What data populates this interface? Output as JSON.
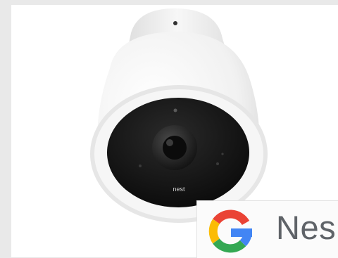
{
  "product_photo": {
    "subject": "security-camera",
    "lens_brand_text": "nest"
  },
  "overlay": {
    "logo": "google-g-logo",
    "text": "Nes"
  },
  "colors": {
    "page_background": "#e9e9e9",
    "photo_background": "#ffffff",
    "camera_body": "#f4f4f4",
    "lens_face": "#141414",
    "google_blue": "#4285f4",
    "google_red": "#ea4335",
    "google_yellow": "#fbbc05",
    "google_green": "#34a853",
    "overlay_text": "#5f6368"
  }
}
